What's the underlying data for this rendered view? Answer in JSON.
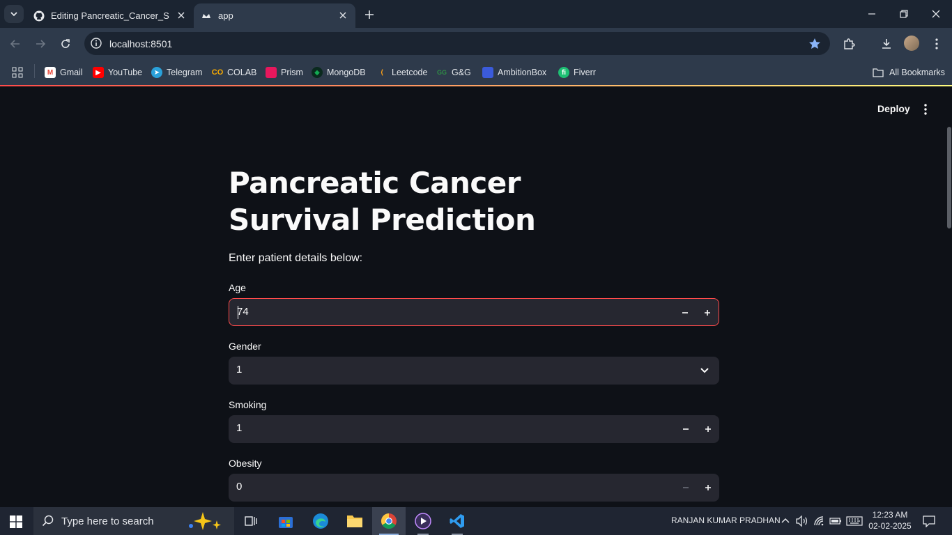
{
  "browser": {
    "tabs": [
      {
        "title": "Editing Pancreatic_Cancer_Survi",
        "active": false,
        "favicon": "github-icon"
      },
      {
        "title": "app",
        "active": true,
        "favicon": "streamlit-icon"
      }
    ],
    "url": "localhost:8501",
    "bookmarks": [
      {
        "label": "Gmail",
        "icon": "gmail-icon"
      },
      {
        "label": "YouTube",
        "icon": "youtube-icon"
      },
      {
        "label": "Telegram",
        "icon": "telegram-icon"
      },
      {
        "label": "COLAB",
        "icon": "colab-icon"
      },
      {
        "label": "Prism",
        "icon": "prism-icon"
      },
      {
        "label": "MongoDB",
        "icon": "mongodb-icon"
      },
      {
        "label": "Leetcode",
        "icon": "leetcode-icon"
      },
      {
        "label": "G&G",
        "icon": "gfg-icon"
      },
      {
        "label": "AmbitionBox",
        "icon": "ambitionbox-icon"
      },
      {
        "label": "Fiverr",
        "icon": "fiverr-icon"
      }
    ],
    "all_bookmarks": "All Bookmarks"
  },
  "app": {
    "deploy_label": "Deploy",
    "title": "Pancreatic Cancer Survival Prediction",
    "subtitle": "Enter patient details below:",
    "fields": [
      {
        "label": "Age",
        "value": "74",
        "type": "number",
        "focused": true
      },
      {
        "label": "Gender",
        "value": "1",
        "type": "select"
      },
      {
        "label": "Smoking",
        "value": "1",
        "type": "number"
      },
      {
        "label": "Obesity",
        "value": "0",
        "type": "number",
        "minus_disabled": true
      }
    ]
  },
  "taskbar": {
    "search_placeholder": "Type here to search",
    "user_name": "RANJAN KUMAR PRADHAN",
    "time": "12:23 AM",
    "date": "02-02-2025"
  },
  "colors": {
    "accent": "#ff4b4b",
    "page_bg": "#0e1117",
    "input_bg": "#262730",
    "chrome_bg": "#2e3a4b"
  }
}
